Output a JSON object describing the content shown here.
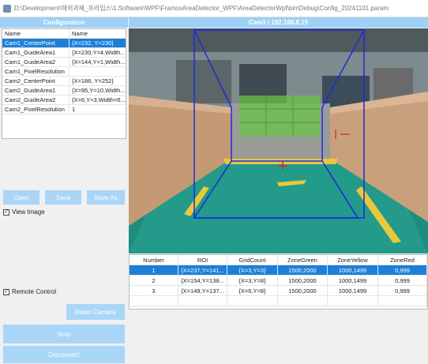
{
  "window": {
    "title": "D:\\Development\\해외과제_프라임스\\1.Software\\WPF\\FramosAreaDetector_WPF\\AreaDetectorWpf\\bin\\Debug\\Config_20241101.param"
  },
  "config": {
    "header": "Configuration",
    "columns": [
      "Name",
      "Name"
    ],
    "rows": [
      {
        "name": "Cam1_CenterPoint",
        "value": "{X=232, Y=230}"
      },
      {
        "name": "Cam1_GuideArea1",
        "value": "{X=230,Y=4,Width..."
      },
      {
        "name": "Cam1_GuideArea2",
        "value": "{X=144,Y=1,Width..."
      },
      {
        "name": "Cam1_PixelResolution",
        "value": ""
      },
      {
        "name": "Cam2_CenterPoint",
        "value": "{X=186, Y=252}"
      },
      {
        "name": "Cam2_GuideArea1",
        "value": "{X=95,Y=10,Width..."
      },
      {
        "name": "Cam2_GuideArea2",
        "value": "{X=6,Y=3,Width=6..."
      },
      {
        "name": "Cam2_PixelResolution",
        "value": "1"
      }
    ],
    "selected_index": 0
  },
  "buttons": {
    "open": "Open",
    "save": "Save",
    "save_as": "Save As",
    "reset_camera": "Reset Camera",
    "stop": "Stop",
    "disconnect": "Disconnect"
  },
  "checkboxes": {
    "view_image": {
      "label": "View Image",
      "checked": true
    },
    "remote_control": {
      "label": "Remote Control",
      "checked": true
    }
  },
  "camera": {
    "header": "Cam1 / 192.168.8.15"
  },
  "results": {
    "columns": [
      "Number",
      "ROI",
      "GridCount",
      "ZoneGreen",
      "ZoneYellow",
      "ZoneRed"
    ],
    "rows": [
      [
        "1",
        "{X=237,Y=141...",
        "{X=3,Y=3}",
        "1500,2000",
        "1000,1499",
        "0,999"
      ],
      [
        "2",
        "{X=154,Y=138...",
        "{X=3,Y=8}",
        "1500,2000",
        "1000,1499",
        "0,999"
      ],
      [
        "3",
        "{X=149,Y=137...",
        "{X=6,Y=8}",
        "1500,2000",
        "1000,1499",
        "0,999"
      ]
    ],
    "selected_index": 0
  },
  "colors": {
    "accent": "#9fd0f5",
    "selection": "#1e7fd8",
    "overlay_blue": "#1a2be0",
    "overlay_red": "#e02020"
  }
}
